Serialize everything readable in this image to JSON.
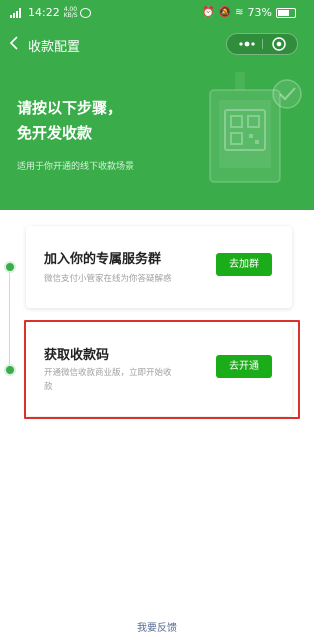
{
  "status_bar": {
    "time": "14:22",
    "net_speed": "4.00 KB/S",
    "battery": "73%"
  },
  "nav": {
    "title": "收款配置"
  },
  "header": {
    "line1": "请按以下步骤，",
    "line2": "免开发收款",
    "subtitle": "适用于你开通的线下收款场景"
  },
  "steps": [
    {
      "title": "加入你的专属服务群",
      "desc": "微信支付小管家在线为你答疑解惑",
      "button": "去加群"
    },
    {
      "title": "获取收款码",
      "desc1": "开通微信收款商业版，立即开始收",
      "desc2": "款",
      "button": "去开通"
    }
  ],
  "footer": {
    "feedback": "我要反馈"
  },
  "colors": {
    "brand_green": "#3aad4a",
    "button_green": "#1aad19",
    "highlight_red": "#d9322a"
  }
}
